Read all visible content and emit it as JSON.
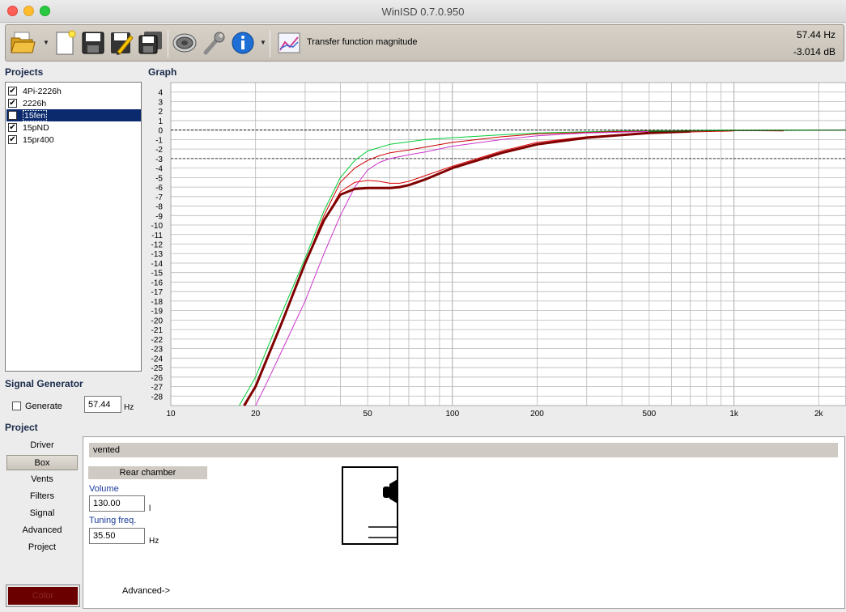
{
  "window": {
    "title": "WinISD 0.7.0.950"
  },
  "toolbar": {
    "graph_type_label": "Transfer function magnitude",
    "readout_freq": "57.44 Hz",
    "readout_db": "-3.014 dB",
    "icons": [
      "open-folder-icon",
      "new-document-icon",
      "save-icon",
      "edit-icon",
      "save-all-icon",
      "driver-icon",
      "tools-icon",
      "info-icon",
      "graph-icon"
    ]
  },
  "projects": {
    "heading": "Projects",
    "items": [
      {
        "label": "4Pi-2226h",
        "checked": true,
        "selected": false
      },
      {
        "label": "2226h",
        "checked": true,
        "selected": false
      },
      {
        "label": "15fen",
        "checked": true,
        "selected": true
      },
      {
        "label": "15pND",
        "checked": true,
        "selected": false
      },
      {
        "label": "15pr400",
        "checked": true,
        "selected": false
      }
    ]
  },
  "signal_generator": {
    "heading": "Signal Generator",
    "generate_label": "Generate",
    "generate_checked": false,
    "frequency": "57.44",
    "unit": "Hz"
  },
  "graph": {
    "heading": "Graph",
    "y_ticks": [
      "4",
      "3",
      "2",
      "1",
      "0",
      "-1",
      "-2",
      "-3",
      "-4",
      "-5",
      "-6",
      "-7",
      "-8",
      "-9",
      "-10",
      "-11",
      "-12",
      "-13",
      "-14",
      "-15",
      "-16",
      "-17",
      "-18",
      "-19",
      "-20",
      "-21",
      "-22",
      "-23",
      "-24",
      "-25",
      "-26",
      "-27",
      "-28"
    ],
    "x_tick_labels": [
      {
        "f": 10,
        "label": "10"
      },
      {
        "f": 20,
        "label": "20"
      },
      {
        "f": 50,
        "label": "50"
      },
      {
        "f": 100,
        "label": "100"
      },
      {
        "f": 200,
        "label": "200"
      },
      {
        "f": 500,
        "label": "500"
      },
      {
        "f": 1000,
        "label": "1k"
      },
      {
        "f": 2000,
        "label": "2k"
      }
    ],
    "colors": {
      "grid": "#b8b8b8",
      "bg": "#ffffff"
    }
  },
  "chart_data": {
    "type": "line",
    "x_scale": "log",
    "xlim": [
      10,
      2500
    ],
    "ylim": [
      -29,
      5
    ],
    "reference_lines": [
      0,
      -3
    ],
    "series": [
      {
        "color": "#00cc33",
        "width": 1,
        "points": [
          [
            17.5,
            -29
          ],
          [
            20,
            -26
          ],
          [
            25,
            -19
          ],
          [
            30,
            -13.5
          ],
          [
            35,
            -8.5
          ],
          [
            40,
            -5
          ],
          [
            45,
            -3.2
          ],
          [
            50,
            -2.2
          ],
          [
            60,
            -1.5
          ],
          [
            80,
            -1
          ],
          [
            100,
            -0.8
          ],
          [
            150,
            -0.5
          ],
          [
            200,
            -0.3
          ],
          [
            400,
            -0.1
          ],
          [
            1000,
            0
          ],
          [
            2500,
            0
          ]
        ]
      },
      {
        "color": "#cc0000",
        "width": 1,
        "points": [
          [
            18.2,
            -29
          ],
          [
            20,
            -27
          ],
          [
            25,
            -20
          ],
          [
            30,
            -14
          ],
          [
            35,
            -9
          ],
          [
            40,
            -5.5
          ],
          [
            45,
            -4
          ],
          [
            50,
            -3.2
          ],
          [
            55,
            -2.7
          ],
          [
            60,
            -2.4
          ],
          [
            70,
            -2.1
          ],
          [
            80,
            -1.8
          ],
          [
            100,
            -1.3
          ],
          [
            150,
            -0.7
          ],
          [
            200,
            -0.4
          ],
          [
            400,
            -0.15
          ],
          [
            1000,
            -0.05
          ],
          [
            1500,
            -0.1
          ]
        ]
      },
      {
        "color": "#cc33cc",
        "width": 1,
        "points": [
          [
            20,
            -29
          ],
          [
            22,
            -26.5
          ],
          [
            25,
            -23
          ],
          [
            30,
            -18
          ],
          [
            35,
            -13
          ],
          [
            40,
            -9
          ],
          [
            45,
            -6
          ],
          [
            50,
            -4.2
          ],
          [
            55,
            -3.4
          ],
          [
            60,
            -3
          ],
          [
            70,
            -2.6
          ],
          [
            80,
            -2.3
          ],
          [
            100,
            -1.7
          ],
          [
            150,
            -1
          ],
          [
            200,
            -0.6
          ],
          [
            300,
            -0.3
          ],
          [
            600,
            -0.1
          ],
          [
            2500,
            0
          ]
        ]
      },
      {
        "color": "#dd0000",
        "width": 1,
        "points": [
          [
            18.4,
            -29
          ],
          [
            20,
            -27
          ],
          [
            25,
            -20
          ],
          [
            30,
            -14
          ],
          [
            35,
            -9.5
          ],
          [
            40,
            -6.5
          ],
          [
            45,
            -5.5
          ],
          [
            50,
            -5.3
          ],
          [
            55,
            -5.4
          ],
          [
            60,
            -5.6
          ],
          [
            65,
            -5.6
          ],
          [
            70,
            -5.4
          ],
          [
            80,
            -4.8
          ],
          [
            100,
            -3.8
          ],
          [
            150,
            -2.2
          ],
          [
            200,
            -1.3
          ],
          [
            300,
            -0.7
          ],
          [
            500,
            -0.3
          ],
          [
            1000,
            -0.1
          ]
        ]
      },
      {
        "color": "#800000",
        "width": 3,
        "points": [
          [
            18.2,
            -29
          ],
          [
            20,
            -27
          ],
          [
            25,
            -20
          ],
          [
            30,
            -14
          ],
          [
            35,
            -9.5
          ],
          [
            40,
            -6.8
          ],
          [
            45,
            -6.2
          ],
          [
            50,
            -6.1
          ],
          [
            60,
            -6.1
          ],
          [
            65,
            -6
          ],
          [
            70,
            -5.8
          ],
          [
            80,
            -5.2
          ],
          [
            100,
            -4
          ],
          [
            150,
            -2.4
          ],
          [
            200,
            -1.5
          ],
          [
            300,
            -0.8
          ],
          [
            500,
            -0.3
          ],
          [
            700,
            -0.15
          ]
        ]
      },
      {
        "color": "#006600",
        "width": 1,
        "points": [
          [
            500,
            -0.15
          ],
          [
            1000,
            -0.05
          ],
          [
            2500,
            0
          ]
        ]
      }
    ]
  },
  "project": {
    "heading": "Project",
    "tabs": [
      "Driver",
      "Box",
      "Vents",
      "Filters",
      "Signal",
      "Advanced",
      "Project"
    ],
    "active_tab": "Box",
    "color_button": "Color",
    "color_value": "#6b0000",
    "box_type": "vented",
    "rear_chamber_label": "Rear chamber",
    "volume_label": "Volume",
    "volume_value": "130.00",
    "volume_unit": "l",
    "tuning_label": "Tuning freq.",
    "tuning_value": "35.50",
    "tuning_unit": "Hz",
    "advanced_link": "Advanced->"
  }
}
